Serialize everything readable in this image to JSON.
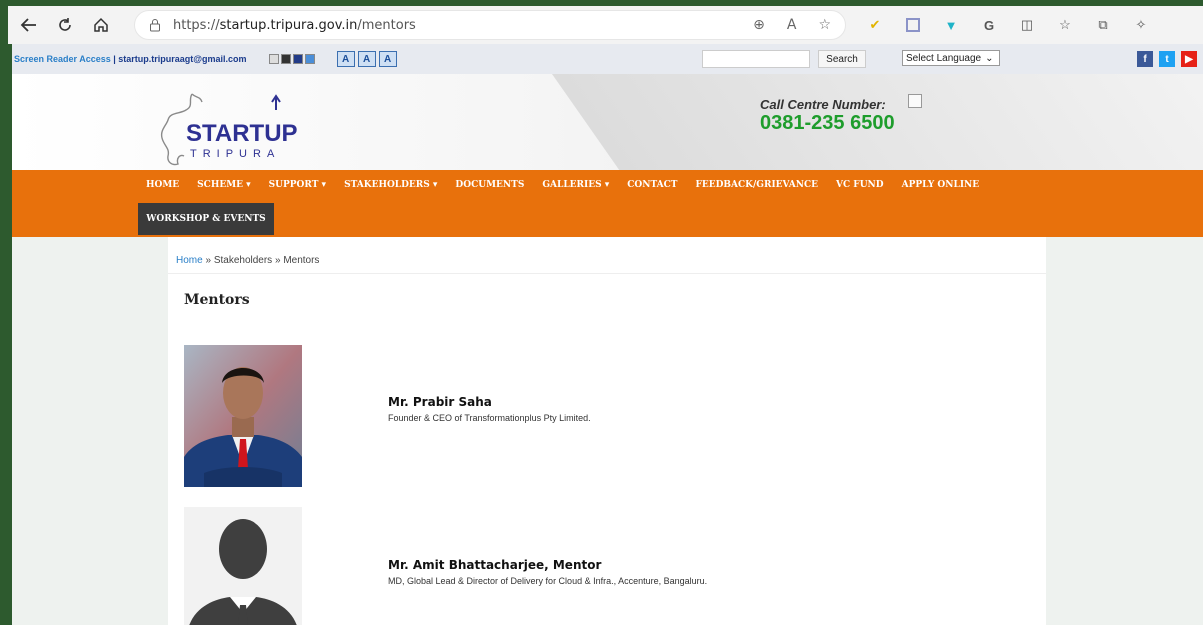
{
  "browser": {
    "url_protocol": "https://",
    "url_host": "startup.tripura.gov.in",
    "url_path": "/mentors"
  },
  "utility": {
    "screen_reader": "Screen Reader Access",
    "separator": " | ",
    "email": "startup.tripuraagt@gmail.com",
    "font_sizes": [
      "A",
      "A",
      "A"
    ],
    "search_label": "Search",
    "language_label": "Select Language"
  },
  "header": {
    "logo_text": "STARTUP",
    "logo_sub": "TRIPURA",
    "call_label": "Call Centre Number:",
    "call_number": "0381-235 6500"
  },
  "nav": {
    "items": [
      "HOME",
      "SCHEME ▾",
      "SUPPORT ▾",
      "STAKEHOLDERS ▾",
      "DOCUMENTS",
      "GALLERIES ▾",
      "CONTACT",
      "FEEDBACK/GRIEVANCE",
      "VC FUND",
      "APPLY ONLINE"
    ],
    "active": "WORKSHOP & EVENTS"
  },
  "breadcrumb": {
    "home": "Home",
    "sep1": " » ",
    "stakeholders": "Stakeholders",
    "sep2": " » ",
    "current": "Mentors"
  },
  "page_title": "Mentors",
  "mentors": [
    {
      "name": "Mr. Prabir Saha",
      "role": "Founder & CEO of Transformationplus Pty Limited."
    },
    {
      "name": "Mr. Amit Bhattacharjee, Mentor",
      "role": "MD, Global Lead & Director of Delivery for Cloud & Infra., Accenture, Bangaluru."
    }
  ],
  "colors": {
    "nav_orange": "#e8710c",
    "nav_active": "#3a3a3a",
    "logo_blue": "#2e3192",
    "call_green": "#1e9d2c",
    "frame_green": "#2d5a2e"
  },
  "icons": {
    "back": "back-arrow-icon",
    "refresh": "refresh-icon",
    "home": "home-icon",
    "lock": "lock-icon",
    "zoom": "zoom-icon",
    "read_aloud": "read-aloud-icon",
    "favorite": "star-icon"
  }
}
